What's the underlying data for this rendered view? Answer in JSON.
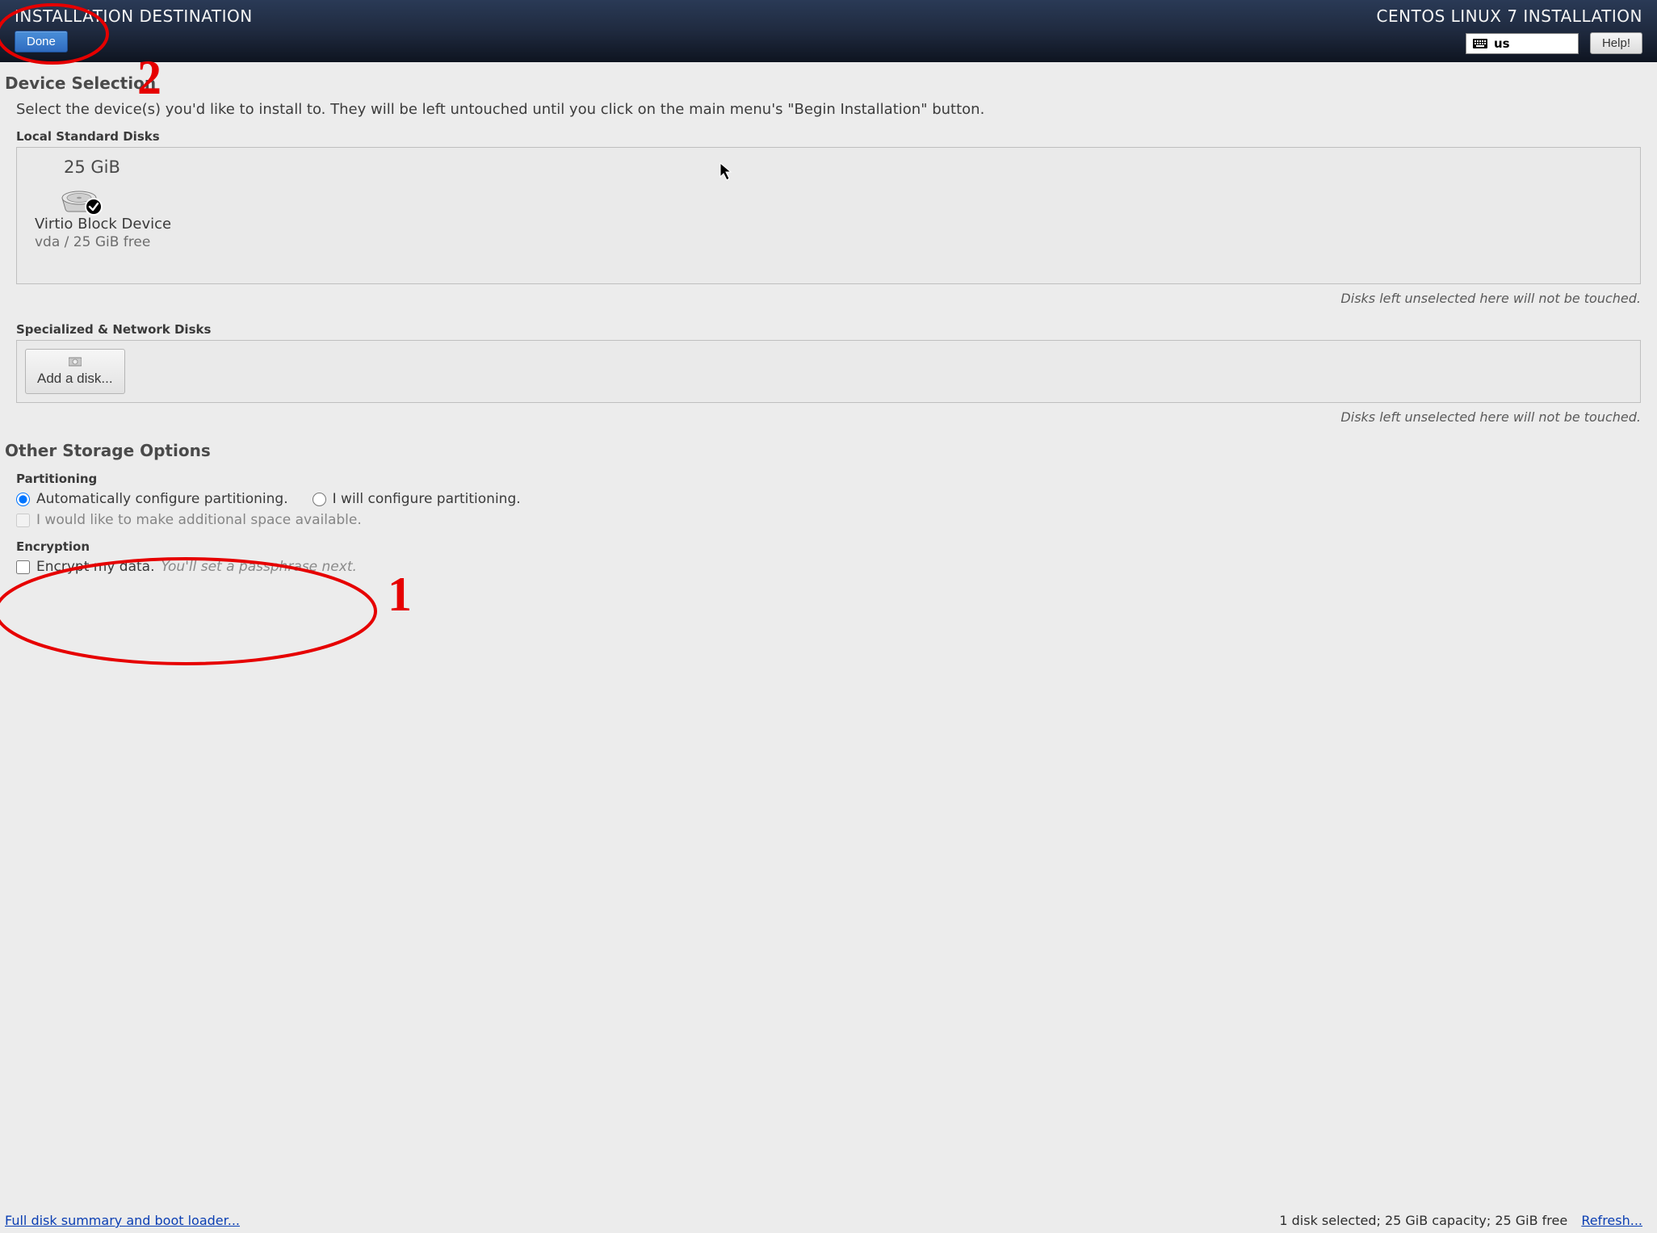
{
  "header": {
    "title_left": "INSTALLATION DESTINATION",
    "title_right": "CENTOS LINUX 7 INSTALLATION",
    "done_label": "Done",
    "keyboard_layout": "us",
    "help_label": "Help!"
  },
  "device_selection": {
    "heading": "Device Selection",
    "description": "Select the device(s) you'd like to install to.  They will be left untouched until you click on the main menu's \"Begin Installation\" button.",
    "local_disks_label": "Local Standard Disks",
    "disks": [
      {
        "size": "25 GiB",
        "name": "Virtio Block Device",
        "device_path": "vda  /  25 GiB free",
        "selected": true
      }
    ],
    "unselected_note": "Disks left unselected here will not be touched.",
    "specialized_label": "Specialized & Network Disks",
    "add_disk_label": "Add a disk..."
  },
  "storage_options": {
    "heading": "Other Storage Options",
    "partitioning_label": "Partitioning",
    "auto_label": "Automatically configure partitioning.",
    "manual_label": "I will configure partitioning.",
    "reclaim_label": "I would like to make additional space available.",
    "encryption_label": "Encryption",
    "encrypt_label": "Encrypt my data.",
    "encrypt_hint": "You'll set a passphrase next."
  },
  "footer": {
    "summary_link": "Full disk summary and boot loader...",
    "status": "1 disk selected; 25 GiB capacity; 25 GiB free",
    "refresh_link": "Refresh..."
  },
  "annotations": {
    "mark1": "1",
    "mark2": "2"
  }
}
